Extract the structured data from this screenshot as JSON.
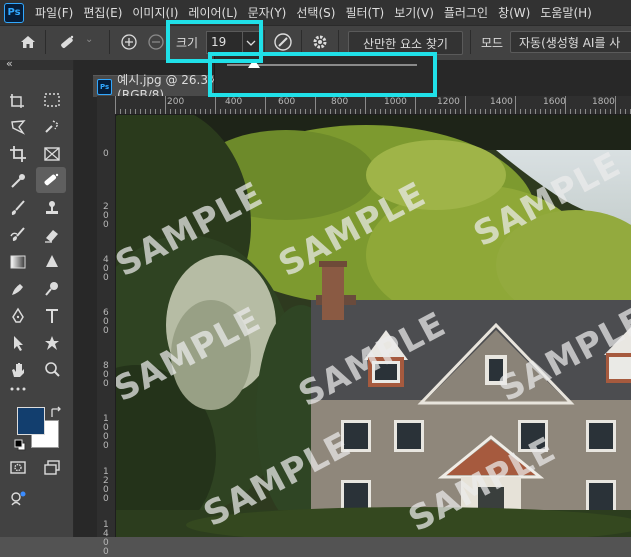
{
  "app": {
    "logo_text": "Ps"
  },
  "menu": {
    "items": [
      "파일(F)",
      "편집(E)",
      "이미지(I)",
      "레이어(L)",
      "문자(Y)",
      "선택(S)",
      "필터(T)",
      "보기(V)",
      "플러그인",
      "창(W)",
      "도움말(H)"
    ]
  },
  "options": {
    "size_label": "크기",
    "size_value": "19",
    "find_button": "산만한 요소 찾기",
    "mode_label": "모드",
    "mode_value": "자동(생성형 AI를 사"
  },
  "document": {
    "tab_title": "예시.jpg @ 26.3% (RGB/8)"
  },
  "rulers": {
    "h_labels": [
      "200",
      "400",
      "600",
      "800",
      "1000",
      "1200",
      "1400",
      "1600",
      "1800"
    ],
    "v_labels": [
      "0",
      "200",
      "400",
      "600",
      "800",
      "1000",
      "1200",
      "1400"
    ]
  },
  "watermark": {
    "text": "SAMPLE"
  },
  "colors": {
    "accent_highlight": "#20e0e8",
    "foreground": "#123e6e",
    "background": "#ffffff"
  },
  "slider": {
    "fraction": 0.14
  }
}
